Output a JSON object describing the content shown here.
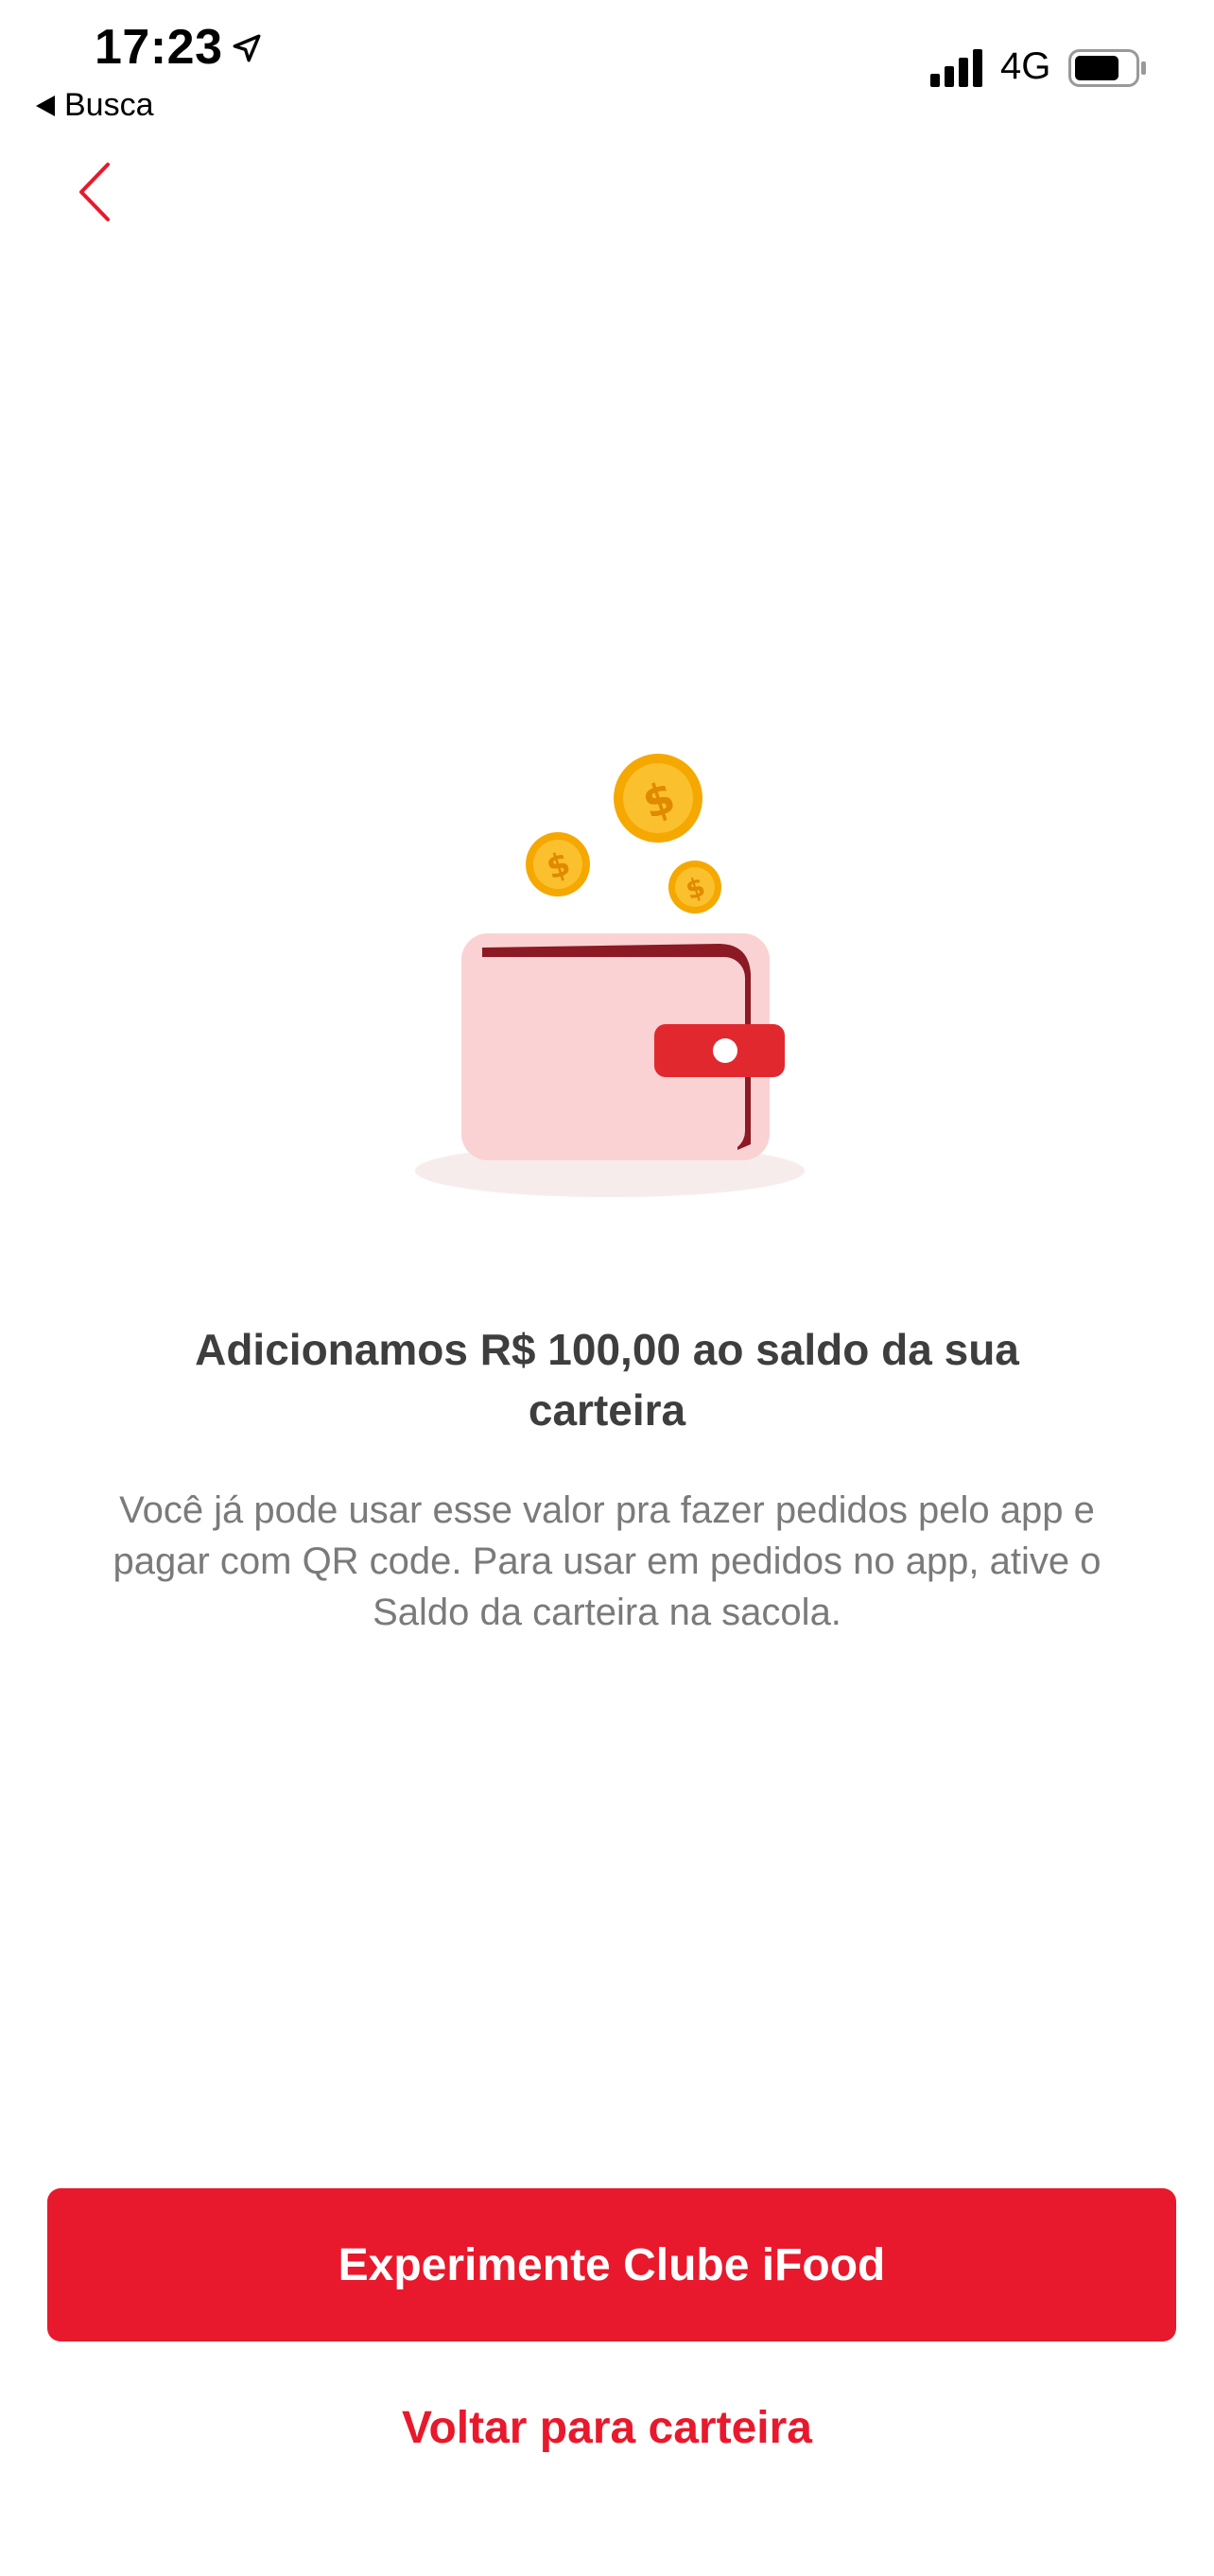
{
  "status_bar": {
    "time": "17:23",
    "back_app_label": "Busca",
    "network": "4G"
  },
  "icons": {
    "location": "location-arrow-icon",
    "signal": "cellular-signal-icon",
    "battery": "battery-icon",
    "back": "chevron-left-icon",
    "illustration": "wallet-with-coins-illustration"
  },
  "colors": {
    "accent": "#e8192c",
    "title": "#3e3e3e",
    "body_text": "#7a7a7a",
    "wallet_body": "#fbd2d3",
    "wallet_dark": "#8b1a24",
    "coin": "#f5a800"
  },
  "content": {
    "title": "Adicionamos R$ 100,00 ao saldo da sua carteira",
    "description": "Você já pode usar esse valor pra fazer pedidos pelo app e pagar com QR code. Para usar em pedidos no app, ative o Saldo da carteira na sacola."
  },
  "actions": {
    "primary_label": "Experimente Clube iFood",
    "secondary_label": "Voltar para carteira"
  }
}
